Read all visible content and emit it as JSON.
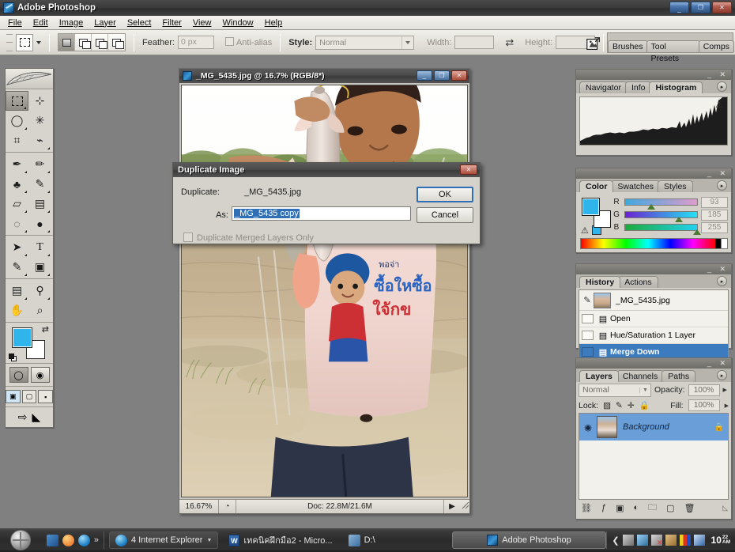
{
  "app": {
    "title": "Adobe Photoshop",
    "icon": "photoshop-icon",
    "window_controls": {
      "minimize": "_",
      "restore": "❐",
      "close": "✕"
    }
  },
  "menubar": {
    "items": [
      {
        "label": "File"
      },
      {
        "label": "Edit"
      },
      {
        "label": "Image"
      },
      {
        "label": "Layer"
      },
      {
        "label": "Select"
      },
      {
        "label": "Filter"
      },
      {
        "label": "View"
      },
      {
        "label": "Window"
      },
      {
        "label": "Help"
      }
    ]
  },
  "options_bar": {
    "tool": "rectangular-marquee",
    "selection_modes": [
      "new-selection",
      "add-to-selection",
      "subtract-from-selection",
      "intersect-with-selection"
    ],
    "feather_label": "Feather:",
    "feather_value": "0 px",
    "antialias_label": "Anti-alias",
    "style_label": "Style:",
    "style_value": "Normal",
    "width_label": "Width:",
    "width_value": "",
    "height_label": "Height:",
    "height_value": "",
    "swap_icon": "swap-width-height-icon",
    "dock_icon": "go-to-bridge-icon"
  },
  "palette_well": {
    "tabs": [
      "Brushes",
      "Tool Presets",
      "Comps"
    ]
  },
  "toolbox": {
    "groups": [
      {
        "tools": [
          {
            "name": "rectangular-marquee-tool",
            "glyph": "",
            "active": true
          },
          {
            "name": "move-tool",
            "glyph": "➤"
          }
        ]
      },
      {
        "tools": [
          {
            "name": "lasso-tool",
            "glyph": "◠"
          },
          {
            "name": "magic-wand-tool",
            "glyph": "✳"
          },
          {
            "name": "crop-tool",
            "glyph": "⌗"
          },
          {
            "name": "slice-tool",
            "glyph": "✂"
          }
        ]
      },
      {
        "tools": [
          {
            "name": "healing-brush-tool",
            "glyph": "✒"
          },
          {
            "name": "brush-tool",
            "glyph": "✏"
          },
          {
            "name": "clone-stamp-tool",
            "glyph": "♣"
          },
          {
            "name": "history-brush-tool",
            "glyph": "✎"
          },
          {
            "name": "eraser-tool",
            "glyph": "▱"
          },
          {
            "name": "gradient-tool",
            "glyph": "▤"
          },
          {
            "name": "blur-tool",
            "glyph": "💧"
          },
          {
            "name": "dodge-tool",
            "glyph": "●"
          }
        ]
      },
      {
        "tools": [
          {
            "name": "path-selection-tool",
            "glyph": "➚"
          },
          {
            "name": "type-tool",
            "glyph": "T"
          },
          {
            "name": "pen-tool",
            "glyph": "✐"
          },
          {
            "name": "rectangle-shape-tool",
            "glyph": "▣"
          }
        ]
      },
      {
        "tools": [
          {
            "name": "notes-tool",
            "glyph": "▤"
          },
          {
            "name": "eyedropper-tool",
            "glyph": "⚲"
          },
          {
            "name": "hand-tool",
            "glyph": "✋"
          },
          {
            "name": "zoom-tool",
            "glyph": "🔍"
          }
        ]
      }
    ],
    "colors": {
      "foreground": "#2fb5ec",
      "background": "#ffffff",
      "swap_icon": "swap-colors-icon",
      "default_icon": "default-colors-icon"
    },
    "quickmask": [
      "standard-mode",
      "quick-mask-mode"
    ],
    "screenmodes": [
      "standard-screen-mode",
      "full-screen-with-menubar",
      "full-screen-mode"
    ],
    "jump_to": [
      "edit-in-imageready-icon",
      "jump-to-icon"
    ]
  },
  "document": {
    "title": "_MG_5435.jpg @ 16.7% (RGB/8*)",
    "window_controls": {
      "minimize": "_",
      "maximize": "❐",
      "close": "✕"
    },
    "status": {
      "zoom": "16.67%",
      "preview_icon": "preview-icon",
      "doc_info": "Doc: 22.8M/21.6M",
      "arrow": "▶"
    },
    "image_description": "photo of a boy in a pink tank top holding a fish by a muddy river"
  },
  "dialog": {
    "title": "Duplicate Image",
    "close_icon": "✕",
    "duplicate_label": "Duplicate:",
    "duplicate_value": "_MG_5435.jpg",
    "as_label": "As:",
    "as_value": "_MG_5435 copy",
    "merged_label": "Duplicate Merged Layers Only",
    "merged_checked": false,
    "ok_label": "OK",
    "cancel_label": "Cancel"
  },
  "palettes": {
    "histogram": {
      "tabs": [
        "Navigator",
        "Info",
        "Histogram"
      ],
      "active_tab": "Histogram",
      "warning_icon": "cached-data-warning-icon",
      "menu_icon": "palette-menu-icon"
    },
    "color": {
      "tabs": [
        "Color",
        "Swatches",
        "Styles"
      ],
      "active_tab": "Color",
      "menu_icon": "palette-menu-icon",
      "foreground": "#2fb5ec",
      "background": "#ffffff",
      "out_of_gamut_icon": "gamut-warning-icon",
      "channels": [
        {
          "label": "R",
          "value": "93",
          "pos": 36
        },
        {
          "label": "G",
          "value": "185",
          "pos": 72
        },
        {
          "label": "B",
          "value": "255",
          "pos": 100
        }
      ]
    },
    "history": {
      "tabs": [
        "History",
        "Actions"
      ],
      "active_tab": "History",
      "menu_icon": "palette-menu-icon",
      "snapshot": "_MG_5435.jpg",
      "states": [
        {
          "label": "Open",
          "selected": false
        },
        {
          "label": "Hue/Saturation 1 Layer",
          "selected": false
        },
        {
          "label": "Merge Down",
          "selected": true
        }
      ],
      "footer_icons": [
        "create-document-from-state-icon",
        "create-new-snapshot-icon",
        "delete-state-icon"
      ]
    },
    "layers": {
      "tabs": [
        "Layers",
        "Channels",
        "Paths"
      ],
      "active_tab": "Layers",
      "menu_icon": "palette-menu-icon",
      "blend_mode": "Normal",
      "opacity_label": "Opacity:",
      "opacity_value": "100%",
      "lock_label": "Lock:",
      "lock_icons": [
        "lock-transparent-pixels-icon",
        "lock-image-pixels-icon",
        "lock-position-icon",
        "lock-all-icon"
      ],
      "fill_label": "Fill:",
      "fill_value": "100%",
      "rows": [
        {
          "name": "Background",
          "visible": true,
          "locked": true,
          "selected": true
        }
      ],
      "footer_icons": [
        "link-layers-icon",
        "layer-style-icon",
        "layer-mask-icon",
        "adjustment-layer-icon",
        "new-group-icon",
        "new-layer-icon",
        "delete-layer-icon"
      ]
    }
  },
  "taskbar": {
    "start_label": "",
    "quick_launch": [
      "show-desktop-icon",
      "media-player-icon",
      "internet-explorer-icon",
      "more-chevron-icon"
    ],
    "tasks": [
      {
        "label": "4 Internet Explorer",
        "icon": "internet-explorer-icon",
        "grouped": true,
        "active": false
      },
      {
        "label": "เทคนิคฝึกมือ2 - Micro...",
        "icon": "word-icon",
        "grouped": false,
        "active": false
      },
      {
        "label": "D:\\",
        "icon": "folder-icon",
        "grouped": false,
        "active": false
      },
      {
        "label": "Adobe Photoshop",
        "icon": "photoshop-icon",
        "grouped": false,
        "active": true
      }
    ],
    "tray_icons": [
      "show-hidden-icons-chevron",
      "network-icon",
      "volume-icon",
      "network-error-icon",
      "antivirus-icon",
      "language-bar-icon",
      "display-icon"
    ],
    "clock": {
      "time": "10",
      "separator": "",
      "meridiem_top": "22",
      "meridiem_bottom": "AM"
    }
  }
}
